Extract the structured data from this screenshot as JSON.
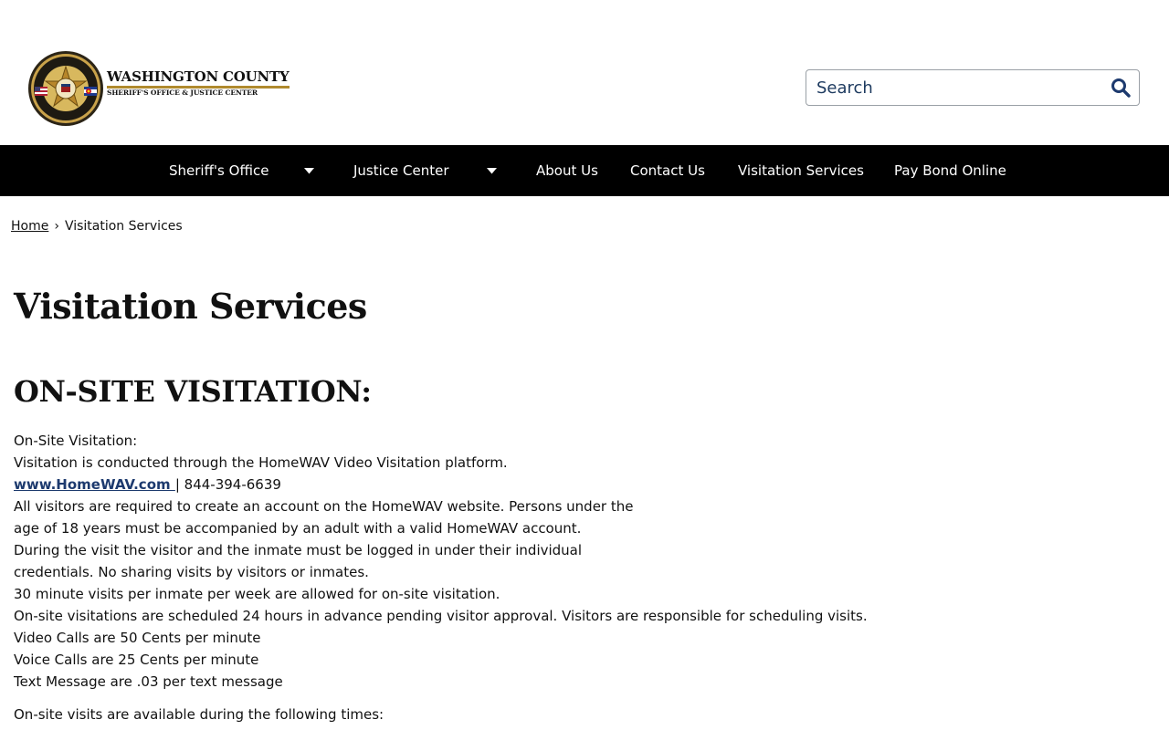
{
  "header": {
    "logo_title": "WASHINGTON COUNTY",
    "logo_subtitle": "SHERIFF'S OFFICE & JUSTICE CENTER",
    "seal_text": "WASHINGTON COUNTY SHERIFF'S OFFICE",
    "search_placeholder": "Search",
    "search_icon": "search-icon"
  },
  "nav": {
    "items": [
      {
        "label": "Sheriff's Office",
        "has_dropdown": true
      },
      {
        "label": "Justice Center",
        "has_dropdown": true
      },
      {
        "label": "About Us"
      },
      {
        "label": "Contact Us"
      },
      {
        "label": "Visitation Services"
      },
      {
        "label": "Pay Bond Online"
      }
    ]
  },
  "breadcrumb": {
    "home": "Home",
    "separator": "›",
    "current": "Visitation Services"
  },
  "page": {
    "title": "Visitation Services",
    "section_title": "ON-SITE VISITATION:",
    "lines": [
      "On-Site Visitation:",
      "Visitation is conducted through the HomeWAV Video Visitation platform.",
      "",
      "All visitors are required to create an account on the HomeWAV website. Persons under the",
      "age of 18 years must be accompanied by an adult with a valid HomeWAV account.",
      "During the visit the visitor and the inmate must be logged in under their individual",
      "credentials. No sharing visits by visitors or inmates.",
      "30 minute visits per inmate per week are allowed for on-site visitation.",
      "On-site visitations are scheduled 24 hours in advance pending visitor approval. Visitors are responsible for scheduling visits.",
      "Video Calls are 50 Cents per minute",
      "Voice Calls are 25 Cents per minute",
      "Text Message are .03 per text message"
    ],
    "homewav_link": "www.HomeWAV.com ",
    "phone": " | 844-394-6639",
    "times_intro": "On-site visits are available during the following times:"
  },
  "colors": {
    "nav_bg": "#000000",
    "link": "#1d3a6e",
    "search_text": "#1d3a5f",
    "logo_accent": "#b08a2e"
  }
}
